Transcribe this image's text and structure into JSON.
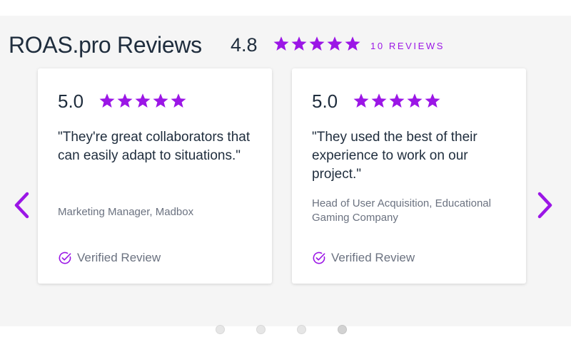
{
  "colors": {
    "accent": "#9b16e6",
    "text_dark": "#1f2d3d",
    "text_muted": "#6b7280",
    "widget_bg": "#f5f5f5",
    "card_bg": "#ffffff"
  },
  "header": {
    "title": "ROAS.pro Reviews",
    "overall_rating": "4.8",
    "stars": 5,
    "count_label": "10 REVIEWS"
  },
  "reviews": [
    {
      "rating": "5.0",
      "stars": 5,
      "quote": "\"They're great collaborators that can easily adapt to situations.\"",
      "author": "Marketing Manager, Madbox",
      "verified_label": "Verified Review"
    },
    {
      "rating": "5.0",
      "stars": 5,
      "quote": "\"They used the best of their experience to work on our project.\"",
      "author": "Head of User Acquisition, Educational Gaming Company",
      "verified_label": "Verified Review"
    }
  ],
  "navigation": {
    "prev_icon": "chevron-left-icon",
    "next_icon": "chevron-right-icon"
  },
  "pagination": {
    "page_count": 4,
    "active_page": 4
  }
}
